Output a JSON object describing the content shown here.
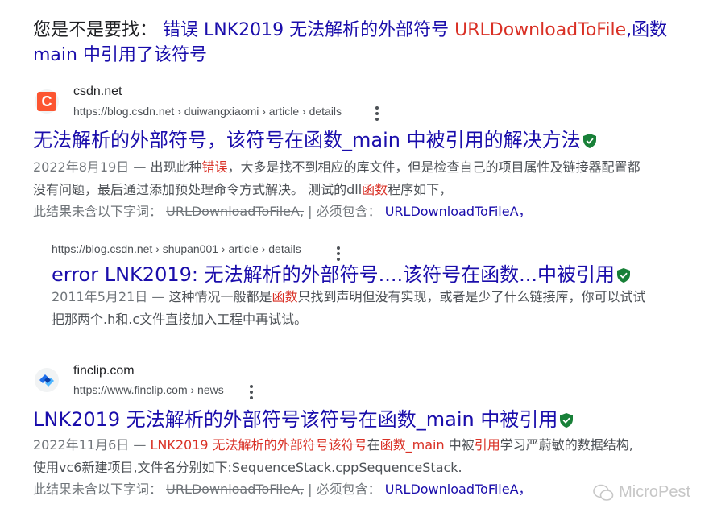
{
  "did_you_mean": {
    "prefix": "您是不是要找：",
    "part1": "错误 LNK2019 无法解析的外部符号",
    "part2": "URLDownloadToFile",
    "part3": ",函数 main 中引用了该符号"
  },
  "results": [
    {
      "site": "csdn.net",
      "url": "https://blog.csdn.net › duiwangxiaomi › article › details",
      "title": "无法解析的外部符号，该符号在函数_main 中被引用的解决方法",
      "date": "2022年8月19日 —",
      "snippet_a": "出现此种",
      "snippet_em1": "错误",
      "snippet_b": "，大多是找不到相应的库文件，但是检查自己的项目属性及链接器配置都没有问题，最后通过添加预处理命令方式解决。 测试的dll",
      "snippet_em2": "函数",
      "snippet_c": "程序如下，",
      "missing_label": "此结果未含以下字词：",
      "missing_term": "URLDownloadToFileA,",
      "must_label": "| 必须包含：",
      "must_term": "URLDownloadToFileA，"
    },
    {
      "url": "https://blog.csdn.net › shupan001 › article › details",
      "title": "error LNK2019: 无法解析的外部符号....该符号在函数...中被引用",
      "date": "2011年5月21日 —",
      "snippet_a": "这种情况一般都是",
      "snippet_em1": "函数",
      "snippet_b": "只找到声明但没有实现，或者是少了什么链接库，你可以试试把那两个.h和.c文件直接加入工程中再试试。"
    },
    {
      "site": "finclip.com",
      "url": "https://www.finclip.com › news",
      "title": "LNK2019 无法解析的外部符号该符号在函数_main 中被引用",
      "date": "2022年11月6日 —",
      "snippet_em1": "LNK2019 无法解析的外部符号该符号",
      "snippet_a": "在",
      "snippet_em2": "函数_main",
      "snippet_b": " 中被",
      "snippet_em3": "引用",
      "snippet_c": "学习严蔚敏的数据结构,使用vc6新建项目,文件名分别如下:SequenceStack.cppSequenceStack.",
      "missing_label": "此结果未含以下字词：",
      "missing_term": "URLDownloadToFileA,",
      "must_label": "| 必须包含：",
      "must_term": "URLDownloadToFileA，"
    }
  ],
  "watermark": "MicroPest",
  "colors": {
    "link": "#1a0dab",
    "emphasis": "#d93025",
    "verified": "#188038"
  }
}
